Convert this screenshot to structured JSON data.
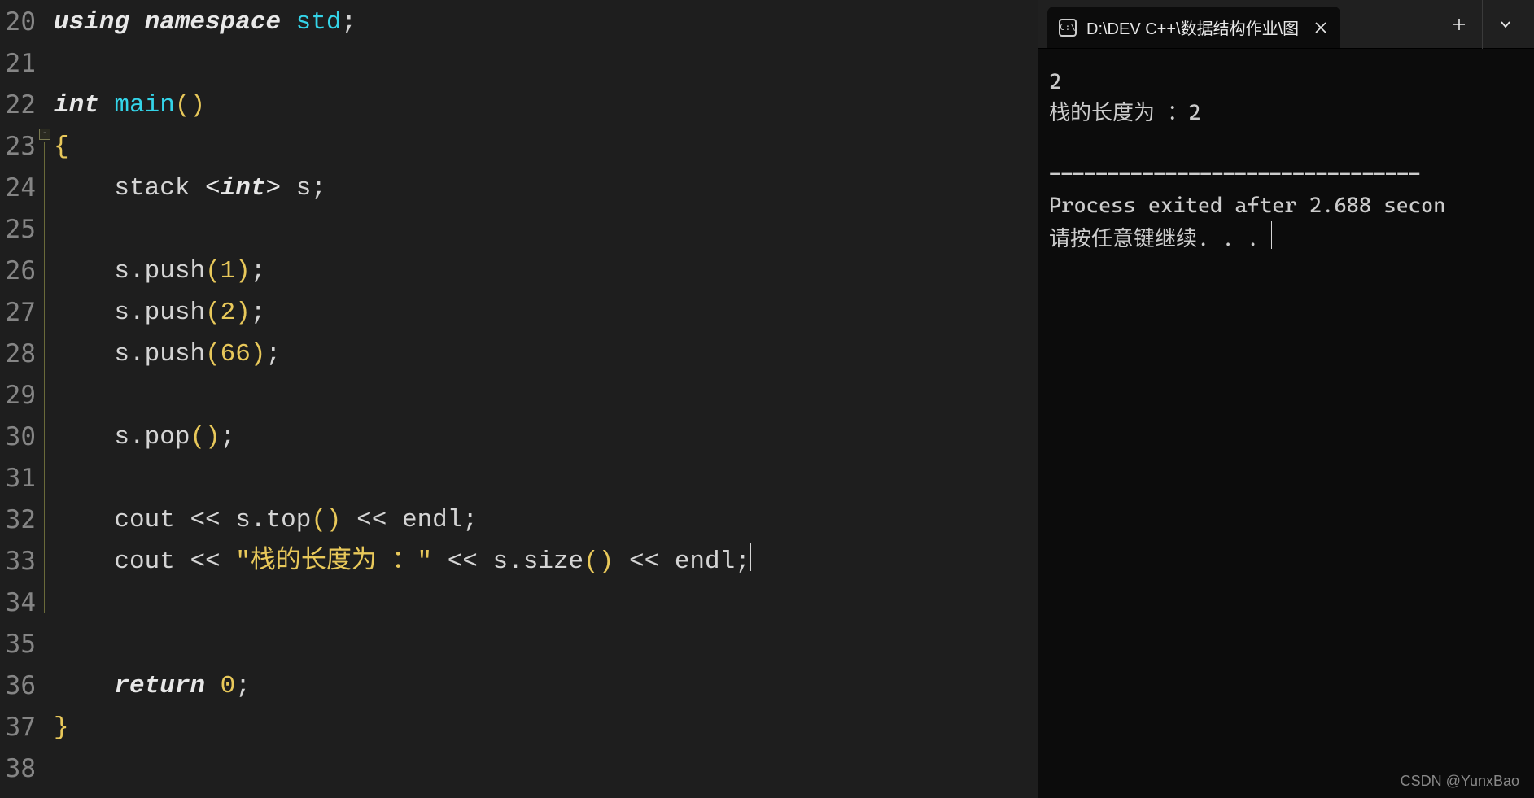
{
  "editor": {
    "line_numbers": [
      "20",
      "21",
      "22",
      "23",
      "24",
      "25",
      "26",
      "27",
      "28",
      "29",
      "30",
      "31",
      "32",
      "33",
      "34",
      "35",
      "36",
      "37",
      "38"
    ],
    "code": {
      "l20": {
        "kw1": "using",
        "kw2": "namespace",
        "ident": "std",
        "semi": ";"
      },
      "l22": {
        "kw": "int",
        "fn": "main",
        "lp": "(",
        "rp": ")"
      },
      "l23": {
        "brace": "{"
      },
      "l24": {
        "stack": "stack",
        "lt": "<",
        "type": "int",
        "gt": ">",
        "var": "s",
        "semi": ";"
      },
      "l26": {
        "obj": "s",
        "dot": ".",
        "fn": "push",
        "lp": "(",
        "arg": "1",
        "rp": ")",
        "semi": ";"
      },
      "l27": {
        "obj": "s",
        "dot": ".",
        "fn": "push",
        "lp": "(",
        "arg": "2",
        "rp": ")",
        "semi": ";"
      },
      "l28": {
        "obj": "s",
        "dot": ".",
        "fn": "push",
        "lp": "(",
        "arg": "66",
        "rp": ")",
        "semi": ";"
      },
      "l30": {
        "obj": "s",
        "dot": ".",
        "fn": "pop",
        "lp": "(",
        "rp": ")",
        "semi": ";"
      },
      "l32": {
        "cout": "cout",
        "op1": "<<",
        "obj": "s",
        "dot": ".",
        "fn": "top",
        "lp": "(",
        "rp": ")",
        "op2": "<<",
        "endl": "endl",
        "semi": ";"
      },
      "l33": {
        "cout": "cout",
        "op1": "<<",
        "str": "\"栈的长度为 ：\"",
        "op2": "<<",
        "obj": "s",
        "dot": ".",
        "fn": "size",
        "lp": "(",
        "rp": ")",
        "op3": "<<",
        "endl": "endl",
        "semi": ";"
      },
      "l36": {
        "kw": "return",
        "val": "0",
        "semi": ";"
      },
      "l37": {
        "brace": "}"
      }
    }
  },
  "terminal": {
    "tab_title": "D:\\DEV C++\\数据结构作业\\图",
    "output_l1": "2",
    "output_l2": "栈的长度为 ：2",
    "dash_line": "--------------------------------",
    "exit_line": "Process exited after 2.688 secon",
    "press_key": "请按任意键继续. . . "
  },
  "watermark": "CSDN @YunxBao"
}
